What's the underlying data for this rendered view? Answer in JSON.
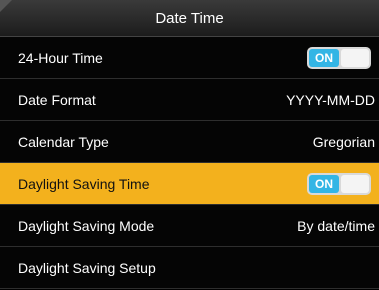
{
  "header": {
    "title": "Date Time"
  },
  "rows": [
    {
      "label": "24-Hour Time",
      "toggle": "ON"
    },
    {
      "label": "Date Format",
      "value": "YYYY-MM-DD"
    },
    {
      "label": "Calendar Type",
      "value": "Gregorian"
    },
    {
      "label": "Daylight Saving Time",
      "toggle": "ON",
      "selected": true
    },
    {
      "label": "Daylight Saving Mode",
      "value": "By date/time"
    },
    {
      "label": "Daylight Saving Setup"
    }
  ],
  "colors": {
    "selected_bg": "#f3b11d",
    "toggle_on": "#33b5e5"
  }
}
